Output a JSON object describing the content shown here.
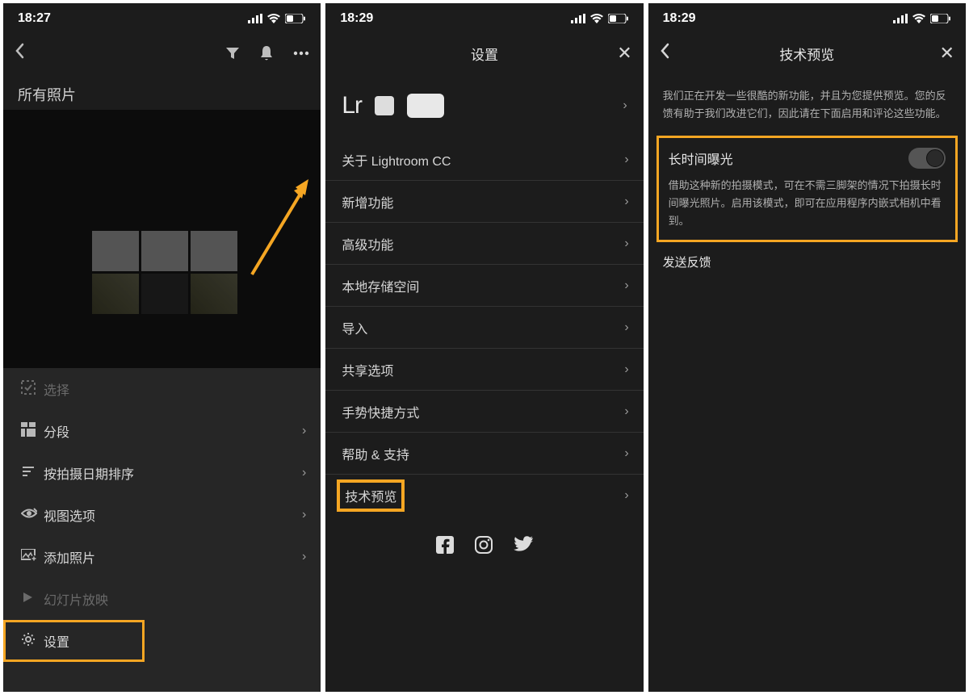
{
  "screen1": {
    "time": "18:27",
    "title": "所有照片",
    "menu": [
      {
        "icon": "select",
        "label": "选择",
        "hasChevron": false,
        "disabled": true
      },
      {
        "icon": "segments",
        "label": "分段",
        "hasChevron": true
      },
      {
        "icon": "sort",
        "label": "按拍摄日期排序",
        "hasChevron": true
      },
      {
        "icon": "view",
        "label": "视图选项",
        "hasChevron": true
      },
      {
        "icon": "add",
        "label": "添加照片",
        "hasChevron": true
      },
      {
        "icon": "play",
        "label": "幻灯片放映",
        "hasChevron": false,
        "disabled": true
      },
      {
        "icon": "gear",
        "label": "设置",
        "hasChevron": false,
        "highlight": true
      }
    ]
  },
  "screen2": {
    "time": "18:29",
    "title": "设置",
    "logoText": "Lr",
    "items": [
      {
        "label": "关于 Lightroom CC"
      },
      {
        "label": "新增功能"
      },
      {
        "label": "高级功能"
      },
      {
        "label": "本地存储空间"
      },
      {
        "label": "导入"
      },
      {
        "label": "共享选项"
      },
      {
        "label": "手势快捷方式"
      },
      {
        "label": "帮助 & 支持"
      },
      {
        "label": "技术预览",
        "highlight": true
      }
    ]
  },
  "screen3": {
    "time": "18:29",
    "title": "技术预览",
    "intro": "我们正在开发一些很酷的新功能，并且为您提供预览。您的反馈有助于我们改进它们，因此请在下面启用和评论这些功能。",
    "toggleLabel": "长时间曝光",
    "desc": "借助这种新的拍摄模式，可在不需三脚架的情况下拍摄长时间曝光照片。启用该模式，即可在应用程序内嵌式相机中看到。",
    "feedback": "发送反馈"
  },
  "colors": {
    "highlight": "#f5a623"
  }
}
